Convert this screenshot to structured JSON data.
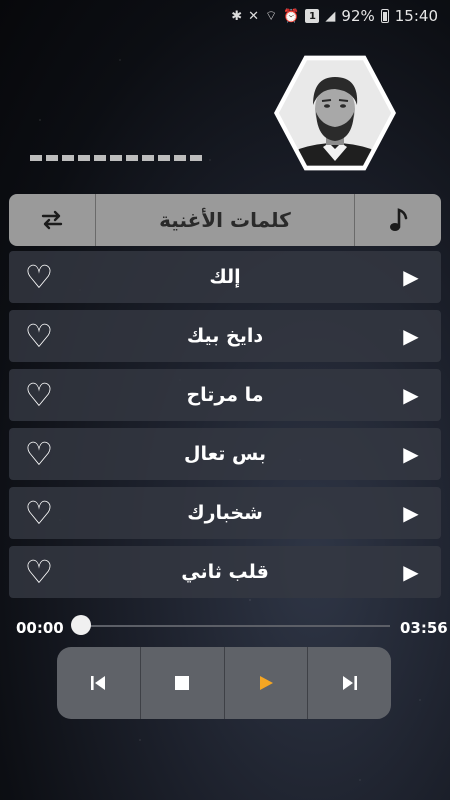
{
  "status_bar": {
    "battery": "92%",
    "time": "15:40",
    "sim_badge": "1",
    "icons": [
      "bluetooth-icon",
      "mute-icon",
      "wifi-icon",
      "alarm-icon",
      "sim-icon",
      "signal-icon",
      "battery-icon"
    ]
  },
  "header": {
    "title": "كلمات الأغنية",
    "left_icon": "repeat-icon",
    "right_icon": "music-note-icon"
  },
  "songs": [
    {
      "title": "إلك"
    },
    {
      "title": "دايخ بيك"
    },
    {
      "title": "ما مرتاح"
    },
    {
      "title": "بس تعال"
    },
    {
      "title": "شخبارك"
    },
    {
      "title": "قلب ثاني"
    }
  ],
  "player": {
    "elapsed": "00:00",
    "duration": "03:56",
    "progress": 0
  },
  "colors": {
    "accent": "#f5a623",
    "panel": "#9a9a9a",
    "row": "#343842"
  }
}
